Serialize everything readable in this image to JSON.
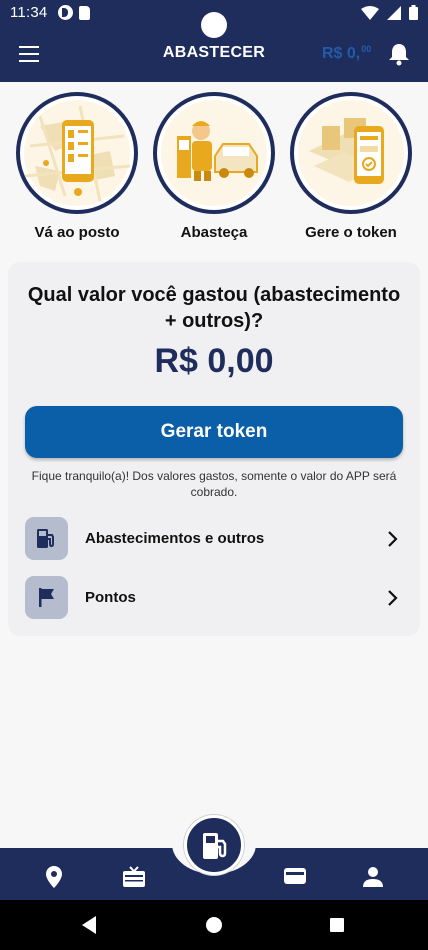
{
  "status_bar": {
    "time": "11:34"
  },
  "header": {
    "title": "ABASTECER",
    "balance_main": "R$ 0,",
    "balance_cents": "00"
  },
  "steps": [
    {
      "label": "Vá ao posto",
      "icon": "map-phone-illustration"
    },
    {
      "label": "Abasteça",
      "icon": "fueling-car-illustration"
    },
    {
      "label": "Gere o token",
      "icon": "token-phone-illustration"
    }
  ],
  "card": {
    "question": "Qual valor você gastou (abastecimento + outros)?",
    "amount": "R$ 0,00",
    "button_label": "Gerar token",
    "note": "Fique tranquilo(a)! Dos valores gastos, somente o valor do APP será cobrado.",
    "rows": [
      {
        "label": "Abastecimentos e outros",
        "icon": "fuel-pump-icon"
      },
      {
        "label": "Pontos",
        "icon": "flag-icon"
      }
    ]
  },
  "bottom_nav": {
    "items": [
      "location-pin-icon",
      "gift-card-icon",
      "fuel-pump-icon",
      "wallet-icon",
      "user-icon"
    ]
  },
  "colors": {
    "primary": "#1f2d5c",
    "button": "#0a5fa8",
    "accent_gold": "#e9a91e",
    "background": "#f7f7f8"
  }
}
